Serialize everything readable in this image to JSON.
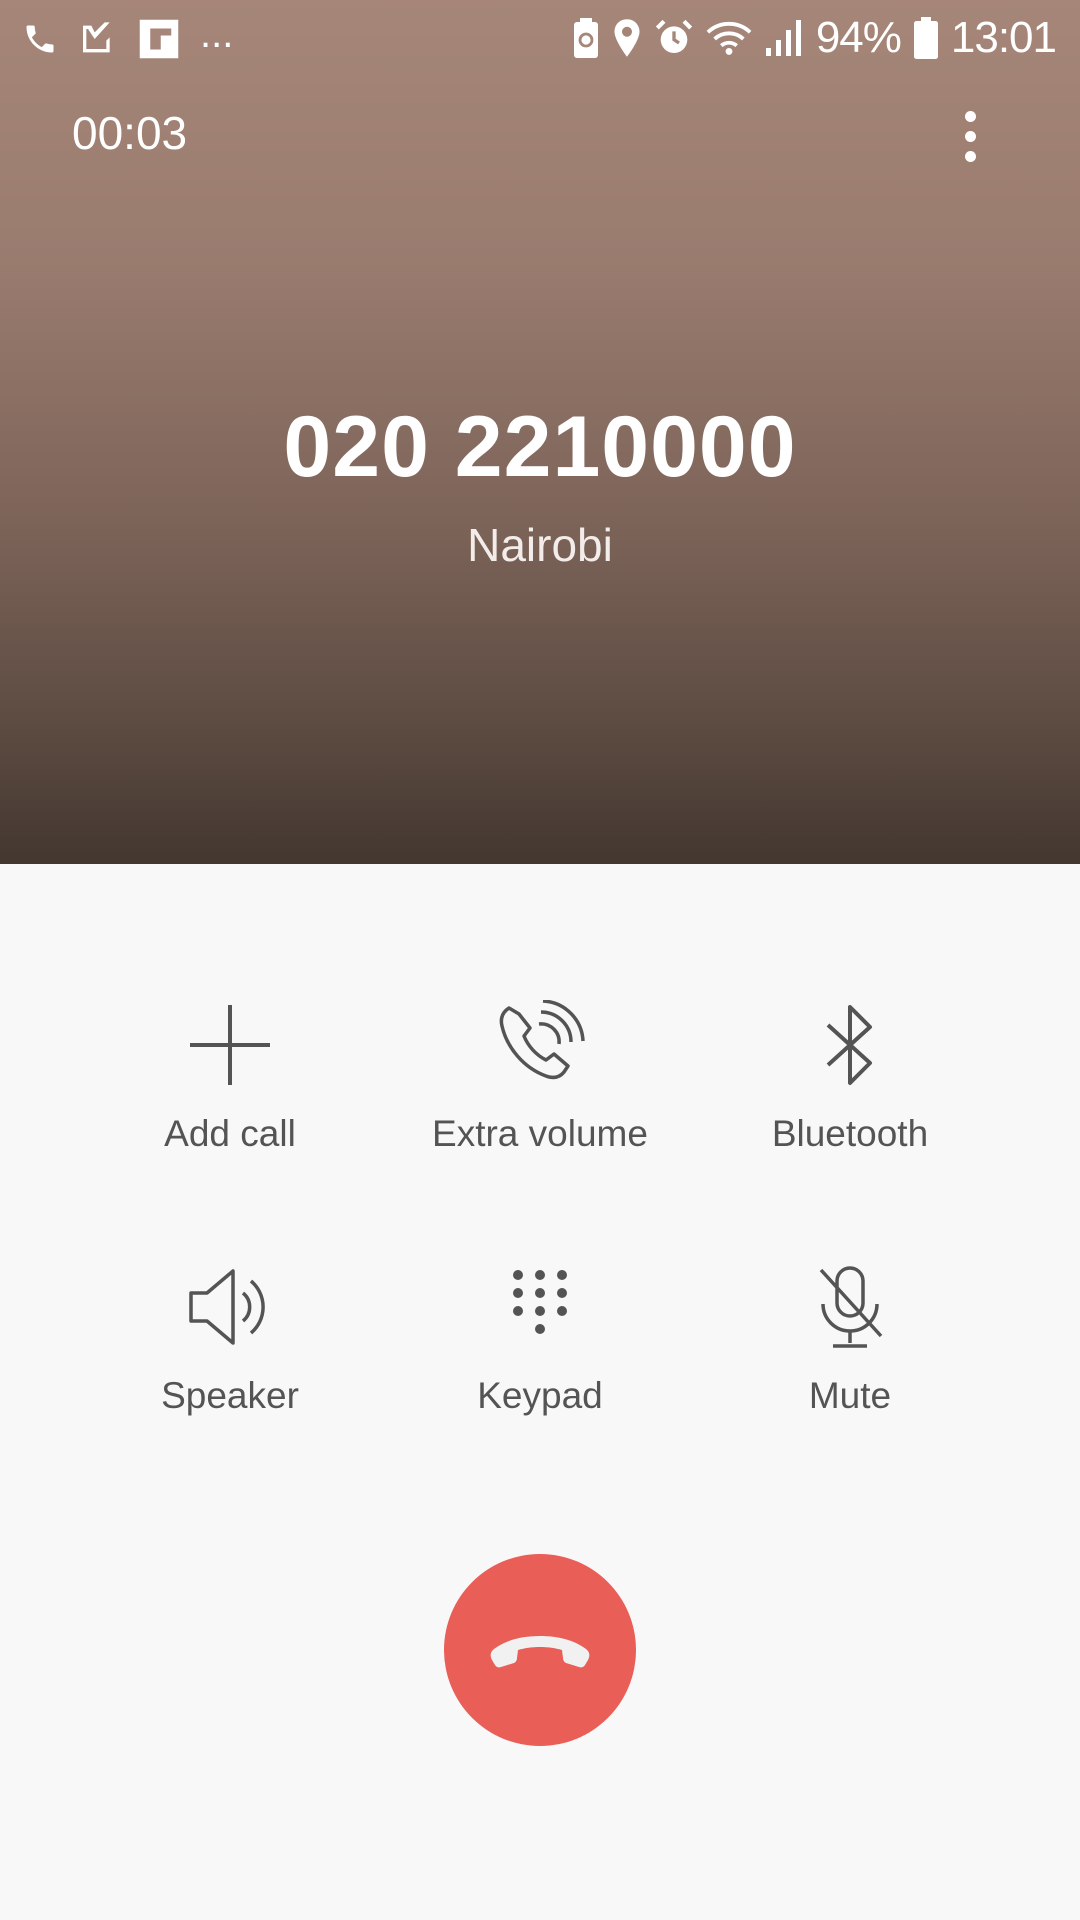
{
  "status_bar": {
    "battery_percent": "94%",
    "time": "13:01",
    "more_notifications": "...",
    "left_icons": [
      "phone-icon",
      "task-check-icon",
      "flipboard-icon"
    ],
    "right_icons": [
      "battery-saver-icon",
      "location-icon",
      "alarm-icon",
      "wifi-icon",
      "signal-icon",
      "battery-icon"
    ]
  },
  "call": {
    "timer": "00:03",
    "number": "020 2210000",
    "location": "Nairobi"
  },
  "controls": {
    "add_call": {
      "label": "Add call",
      "icon": "plus-icon"
    },
    "extra_volume": {
      "label": "Extra volume",
      "icon": "extra-volume-icon"
    },
    "bluetooth": {
      "label": "Bluetooth",
      "icon": "bluetooth-icon"
    },
    "speaker": {
      "label": "Speaker",
      "icon": "speaker-icon"
    },
    "keypad": {
      "label": "Keypad",
      "icon": "keypad-icon"
    },
    "mute": {
      "label": "Mute",
      "icon": "mic-off-icon"
    }
  },
  "end_call": {
    "icon": "end-call-icon",
    "color": "#e95e56"
  },
  "colors": {
    "header_top": "#a58678",
    "header_bottom": "#433730",
    "panel_background": "#f8f8f8",
    "control_icon": "#545454"
  }
}
